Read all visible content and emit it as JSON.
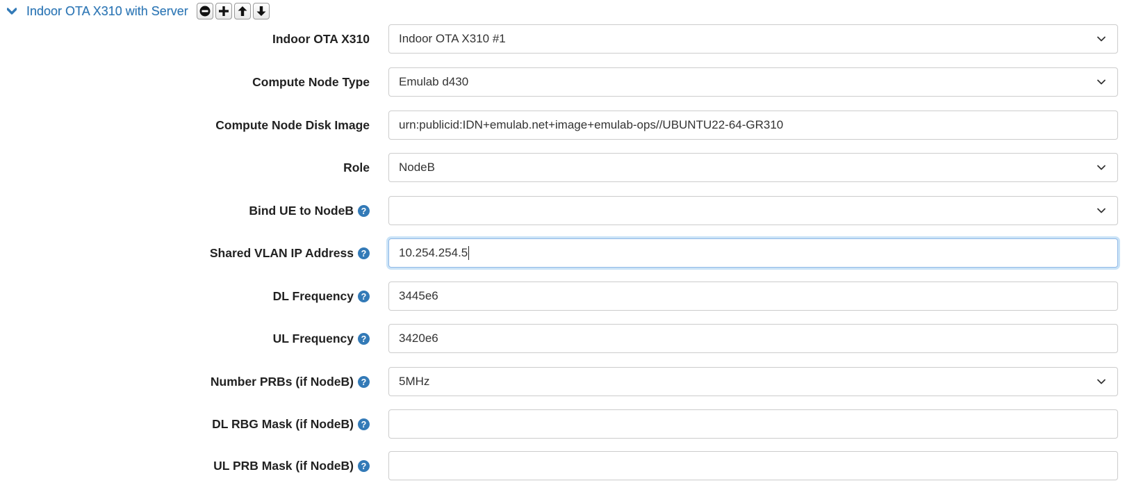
{
  "section": {
    "title": "Indoor OTA X310 with Server",
    "controls": [
      "minus",
      "plus",
      "arrow-up",
      "arrow-down"
    ]
  },
  "fields": [
    {
      "label": "Indoor OTA X310",
      "value": "Indoor OTA X310 #1",
      "type": "select",
      "help": false
    },
    {
      "label": "Compute Node Type",
      "value": "Emulab d430",
      "type": "select",
      "help": false
    },
    {
      "label": "Compute Node Disk Image",
      "value": "urn:publicid:IDN+emulab.net+image+emulab-ops//UBUNTU22-64-GR310",
      "type": "text",
      "help": false
    },
    {
      "label": "Role",
      "value": "NodeB",
      "type": "select",
      "help": false
    },
    {
      "label": "Bind UE to NodeB",
      "value": "",
      "type": "select",
      "help": true
    },
    {
      "label": "Shared VLAN IP Address",
      "value": "10.254.254.5",
      "type": "text",
      "help": true,
      "focused": true
    },
    {
      "label": "DL Frequency",
      "value": "3445e6",
      "type": "text",
      "help": true
    },
    {
      "label": "UL Frequency",
      "value": "3420e6",
      "type": "text",
      "help": true
    },
    {
      "label": "Number PRBs (if NodeB)",
      "value": "5MHz",
      "type": "select",
      "help": true
    },
    {
      "label": "DL RBG Mask (if NodeB)",
      "value": "",
      "type": "text",
      "help": true
    },
    {
      "label": "UL PRB Mask (if NodeB)",
      "value": "",
      "type": "text",
      "help": true
    }
  ],
  "colors": {
    "accent": "#337ab7",
    "focus_border": "#8fb8e6",
    "border": "#cccccc",
    "label": "#222222"
  }
}
